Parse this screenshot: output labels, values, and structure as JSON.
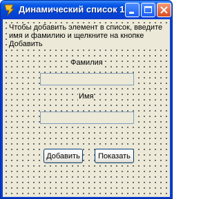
{
  "window": {
    "title": "Динамический список 1"
  },
  "form": {
    "hint": "Чтобы добавить элемент в список, введите имя и фамилию и щелкните на кнопке Добавить",
    "surname_label": "Фамилия",
    "surname_value": "",
    "name_label": "Имя",
    "name_value": ""
  },
  "buttons": {
    "add_label": "Добавить",
    "show_label": "Показать"
  },
  "icons": {
    "app": "delphi-app-icon",
    "minimize": "minimize-icon",
    "maximize": "maximize-icon",
    "close": "close-icon"
  },
  "colors": {
    "title_bar": "#0b3ed0",
    "client_bg": "#ece9d8",
    "close_button": "#d84b1f"
  }
}
